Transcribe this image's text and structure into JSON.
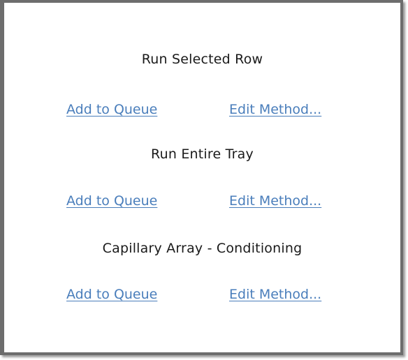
{
  "sections": [
    {
      "title": "Run Selected Row",
      "add_label": "Add to Queue",
      "edit_label": "Edit Method..."
    },
    {
      "title": "Run Entire Tray",
      "add_label": "Add to Queue",
      "edit_label": "Edit Method..."
    },
    {
      "title": "Capillary Array - Conditioning",
      "add_label": "Add to Queue",
      "edit_label": "Edit Method..."
    }
  ],
  "colors": {
    "link": "#4a7ebb",
    "text": "#1a1a1a",
    "border": "#6d6d6d"
  }
}
